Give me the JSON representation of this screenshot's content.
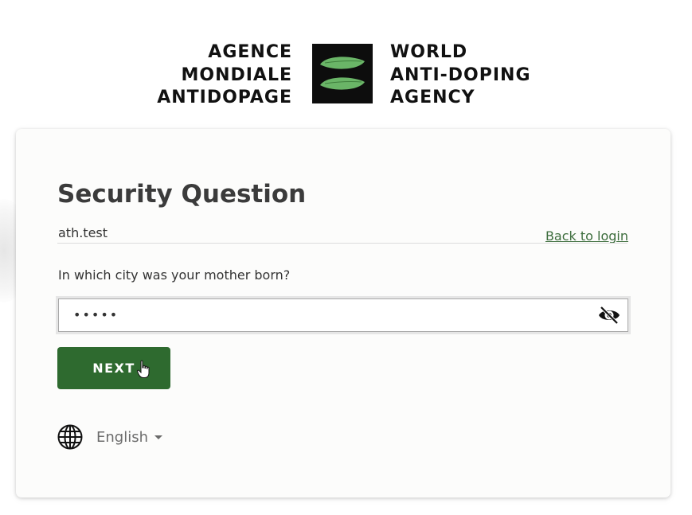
{
  "header": {
    "logo_fr_lines": [
      "AGENCE",
      "MONDIALE",
      "ANTIDOPAGE"
    ],
    "logo_en_lines": [
      "WORLD",
      "ANTI-DOPING",
      "AGENCY"
    ],
    "logo_mark_icon": "wada-leaf-mark-icon",
    "logo_leaf_color": "#6ab567"
  },
  "form": {
    "title": "Security Question",
    "username": "ath.test",
    "back_link": "Back to login",
    "question": "In which city was your mother born?",
    "answer_masked": "•••••",
    "toggle_visibility_icon": "eye-slash-icon",
    "next_label": "NEXT",
    "accent_color": "#2e6a2f"
  },
  "language": {
    "icon": "globe-icon",
    "selected": "English"
  }
}
